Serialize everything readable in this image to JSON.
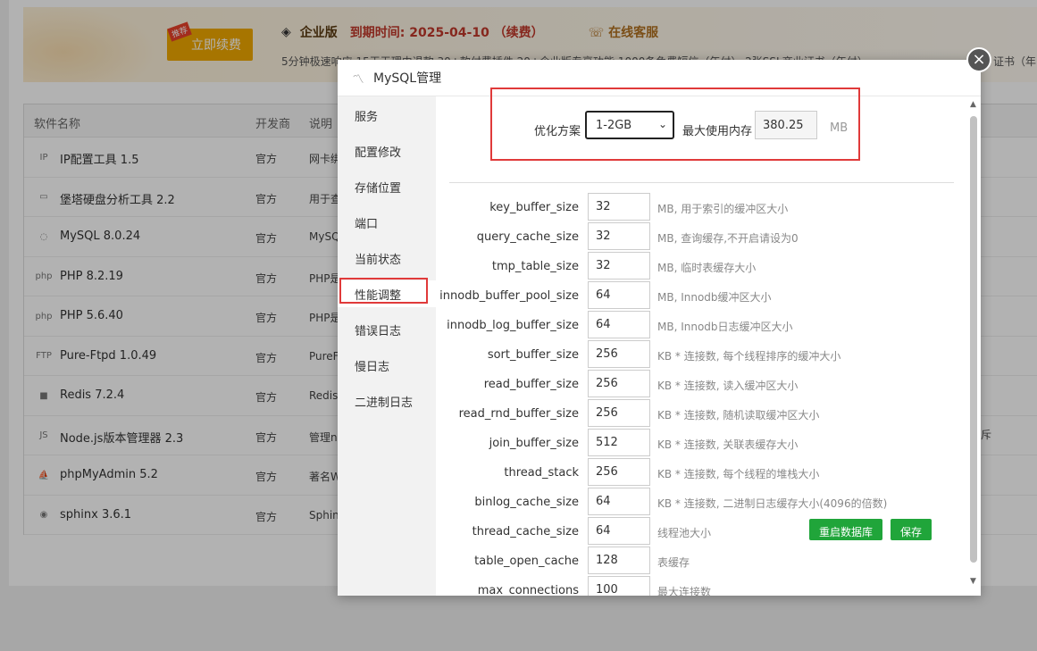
{
  "banner": {
    "renew_button": "立即续费",
    "renew_tag": "推荐",
    "edition": "企业版",
    "expire": "到期时间: 2025-04-10 （续费）",
    "support": "在线客服",
    "features": "5分钟极速响应    15天无理由退款    30+款付费插件    20+企业版专享功能    1000条免费短信（年付）    2张SSL商业证书（年付）",
    "right_text": "证书（年"
  },
  "table": {
    "headers": {
      "name": "软件名称",
      "developer": "开发商",
      "desc": "说明"
    },
    "rows": [
      {
        "name": "IP配置工具 1.5",
        "icon": "IP",
        "developer": "官方",
        "desc": "网卡绑"
      },
      {
        "name": "堡塔硬盘分析工具 2.2",
        "icon": "▭",
        "developer": "官方",
        "desc": "用于查"
      },
      {
        "name": "MySQL 8.0.24",
        "icon": "◌",
        "developer": "官方",
        "desc": "MySQ"
      },
      {
        "name": "PHP 8.2.19",
        "icon": "php",
        "developer": "官方",
        "desc": "PHP是"
      },
      {
        "name": "PHP 5.6.40",
        "icon": "php",
        "developer": "官方",
        "desc": "PHP是"
      },
      {
        "name": "Pure-Ftpd 1.0.49",
        "icon": "FTP",
        "developer": "官方",
        "desc": "PureF"
      },
      {
        "name": "Redis 7.2.4",
        "icon": "■",
        "developer": "官方",
        "desc": "Redis"
      },
      {
        "name": "Node.js版本管理器 2.3",
        "icon": "JS",
        "developer": "官方",
        "desc": "管理n"
      },
      {
        "name": "phpMyAdmin 5.2",
        "icon": "⛵",
        "developer": "官方",
        "desc": "著名W"
      },
      {
        "name": "sphinx 3.6.1",
        "icon": "◉",
        "developer": "官方",
        "desc": "Sphin"
      }
    ],
    "row_right_text": "斥"
  },
  "modal": {
    "title": "MySQL管理",
    "close": "×",
    "sidebar": [
      "服务",
      "配置修改",
      "存储位置",
      "端口",
      "当前状态",
      "性能调整",
      "错误日志",
      "慢日志",
      "二进制日志"
    ],
    "active_index": 5,
    "plan_label": "优化方案",
    "plan_value": "1-2GB",
    "mem_label": "最大使用内存",
    "mem_value": "380.25",
    "mem_unit": "MB",
    "params": [
      {
        "name": "key_buffer_size",
        "value": "32",
        "desc": "MB, 用于索引的缓冲区大小"
      },
      {
        "name": "query_cache_size",
        "value": "32",
        "desc": "MB, 查询缓存,不开启请设为0"
      },
      {
        "name": "tmp_table_size",
        "value": "32",
        "desc": "MB, 临时表缓存大小"
      },
      {
        "name": "innodb_buffer_pool_size",
        "value": "64",
        "desc": "MB, Innodb缓冲区大小"
      },
      {
        "name": "innodb_log_buffer_size",
        "value": "64",
        "desc": "MB, Innodb日志缓冲区大小"
      },
      {
        "name": "sort_buffer_size",
        "value": "256",
        "desc": "KB * 连接数, 每个线程排序的缓冲大小"
      },
      {
        "name": "read_buffer_size",
        "value": "256",
        "desc": "KB * 连接数, 读入缓冲区大小"
      },
      {
        "name": "read_rnd_buffer_size",
        "value": "256",
        "desc": "KB * 连接数, 随机读取缓冲区大小"
      },
      {
        "name": "join_buffer_size",
        "value": "512",
        "desc": "KB * 连接数, 关联表缓存大小"
      },
      {
        "name": "thread_stack",
        "value": "256",
        "desc": "KB * 连接数, 每个线程的堆栈大小"
      },
      {
        "name": "binlog_cache_size",
        "value": "64",
        "desc": "KB * 连接数, 二进制日志缓存大小(4096的倍数)"
      },
      {
        "name": "thread_cache_size",
        "value": "64",
        "desc": "线程池大小"
      },
      {
        "name": "table_open_cache",
        "value": "128",
        "desc": "表缓存"
      },
      {
        "name": "max_connections",
        "value": "100",
        "desc": "最大连接数"
      }
    ],
    "restart_button": "重启数据库",
    "save_button": "保存"
  },
  "colors": {
    "accent_green": "#20a53a",
    "highlight_red": "#e03a3a",
    "banner_orange": "#f0a800"
  }
}
